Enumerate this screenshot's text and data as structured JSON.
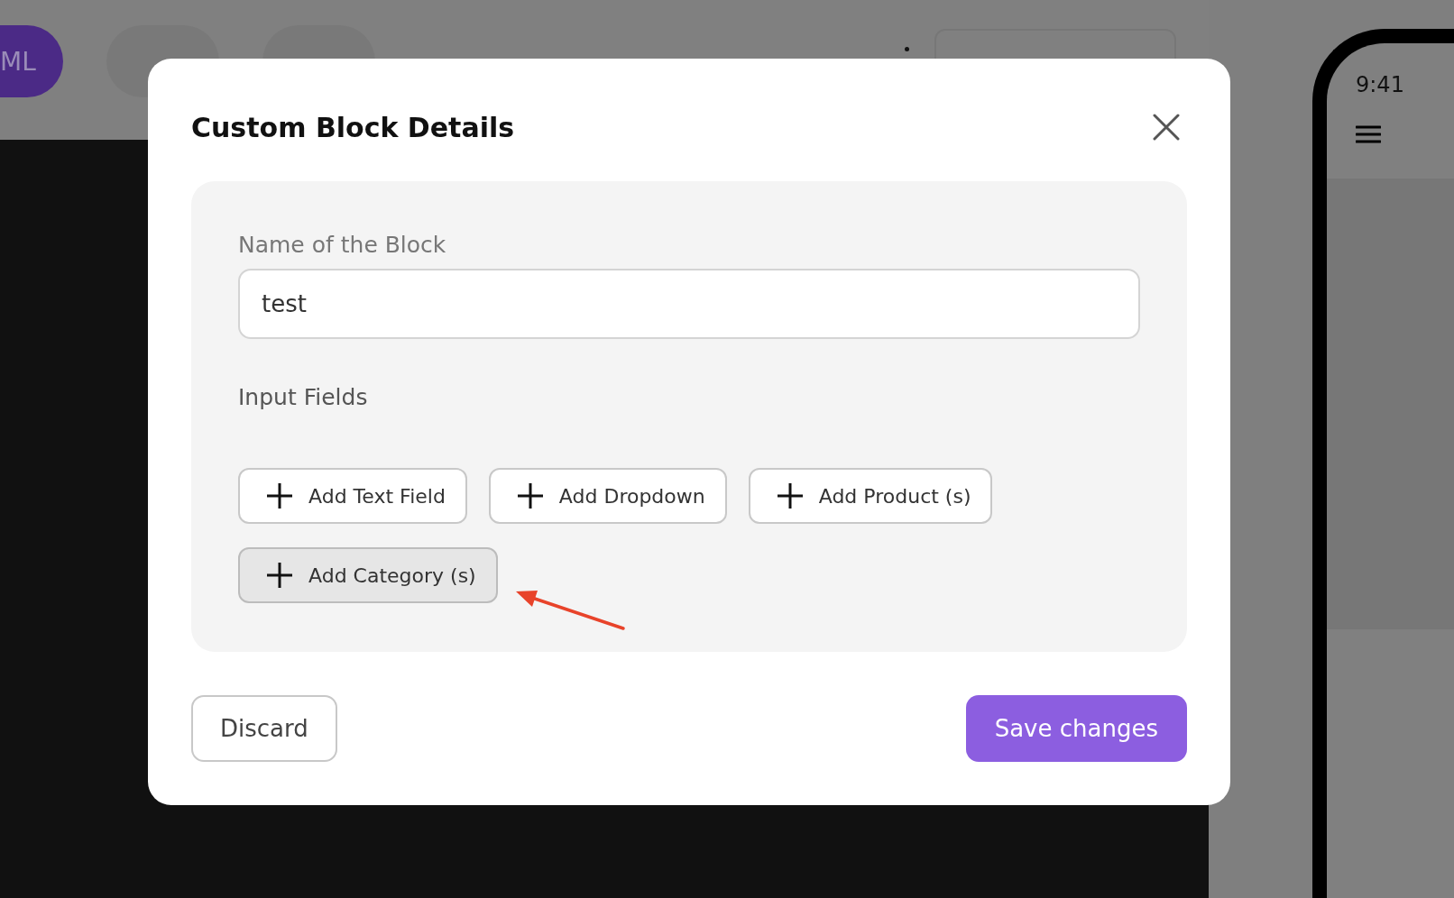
{
  "editor": {
    "tabs": [
      {
        "label": "ML",
        "selected": true
      },
      {
        "selected": false
      },
      {
        "selected": false
      }
    ]
  },
  "phone": {
    "time": "9:41"
  },
  "dialog": {
    "title": "Custom Block Details",
    "name_label": "Name of the Block",
    "name_value": "test",
    "fields_label": "Input Fields",
    "add_buttons": [
      {
        "label": "Add Text Field",
        "highlighted": false
      },
      {
        "label": "Add Dropdown",
        "highlighted": false
      },
      {
        "label": "Add Product (s)",
        "highlighted": false
      },
      {
        "label": "Add Category (s)",
        "highlighted": true
      }
    ],
    "discard": "Discard",
    "save": "Save changes"
  }
}
